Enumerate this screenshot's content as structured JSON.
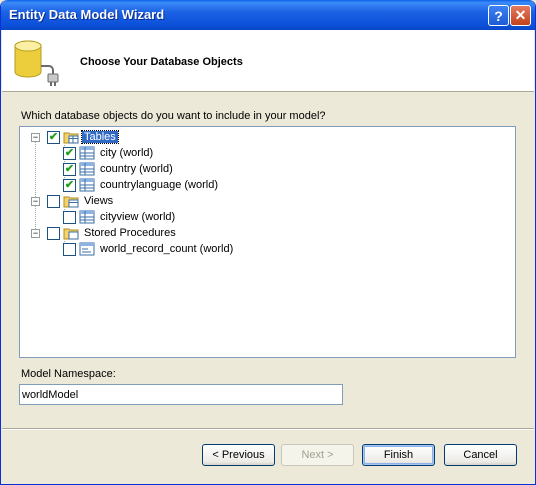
{
  "window": {
    "title": "Entity Data Model Wizard"
  },
  "header": {
    "title": "Choose Your Database Objects"
  },
  "question": "Which database objects do you want to include in your model?",
  "tree": {
    "tables": {
      "label": "Tables",
      "checked": true,
      "children": [
        {
          "label": "city (world)",
          "checked": true
        },
        {
          "label": "country (world)",
          "checked": true
        },
        {
          "label": "countrylanguage (world)",
          "checked": true
        }
      ]
    },
    "views": {
      "label": "Views",
      "checked": false,
      "children": [
        {
          "label": "cityview (world)",
          "checked": false
        }
      ]
    },
    "procs": {
      "label": "Stored Procedures",
      "checked": false,
      "children": [
        {
          "label": "world_record_count (world)",
          "checked": false
        }
      ]
    }
  },
  "namespace": {
    "label": "Model Namespace:",
    "value": "worldModel"
  },
  "buttons": {
    "previous": "< Previous",
    "next": "Next >",
    "finish": "Finish",
    "cancel": "Cancel"
  },
  "checkmark": "✔",
  "expander": "−"
}
